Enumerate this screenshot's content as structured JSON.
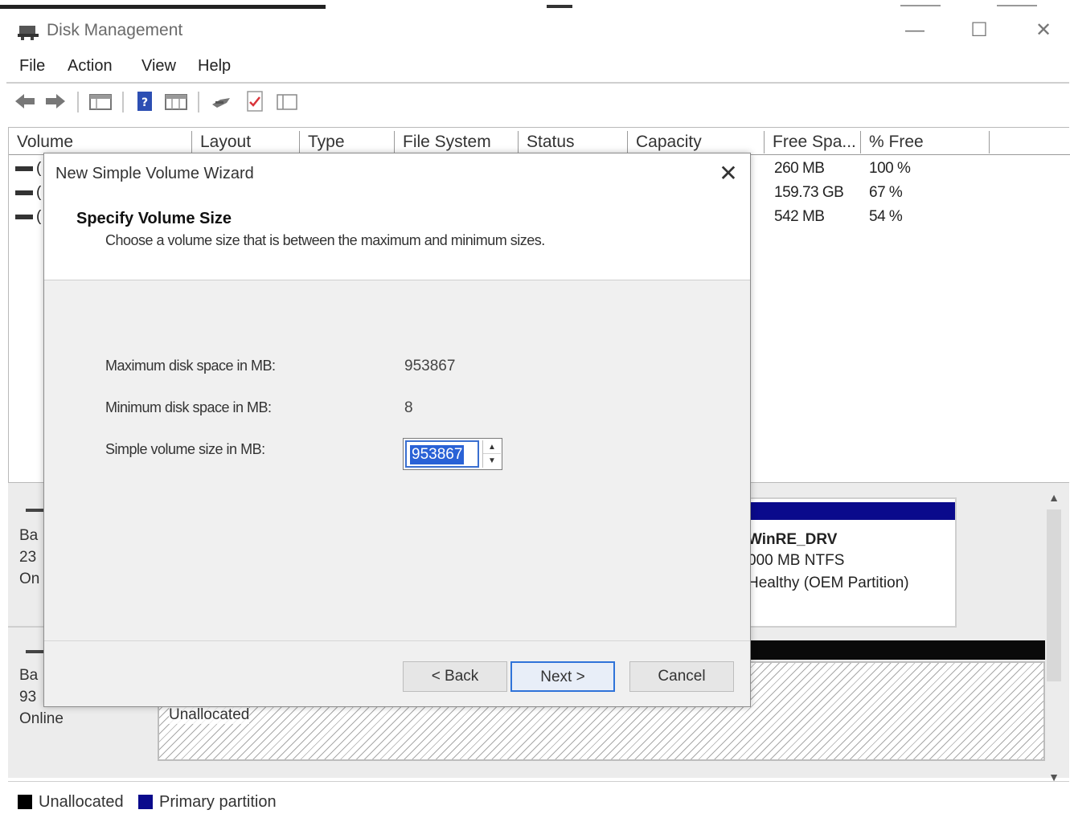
{
  "window": {
    "title": "Disk Management",
    "controls": {
      "minimize": "—",
      "maximize": "☐",
      "close": "✕"
    }
  },
  "menu": [
    "File",
    "Action",
    "View",
    "Help"
  ],
  "toolbar_icons": [
    "back-arrow-icon",
    "forward-arrow-icon",
    "console-tree-icon",
    "help-icon",
    "properties-icon",
    "connect-icon",
    "checklist-icon",
    "panel-icon"
  ],
  "volume_list": {
    "columns": [
      "Volume",
      "Layout",
      "Type",
      "File System",
      "Status",
      "Capacity",
      "Free Spa...",
      "% Free"
    ],
    "rows": [
      {
        "volume": "(",
        "free": "260 MB",
        "pct": "100 %"
      },
      {
        "volume": "(",
        "free": "159.73 GB",
        "pct": "67 %"
      },
      {
        "volume": "(",
        "free": "542 MB",
        "pct": "54 %"
      }
    ]
  },
  "graph": {
    "disk0": {
      "line1": "Ba",
      "line2": "23",
      "line3": "On"
    },
    "disk1": {
      "line1": "Ba",
      "line2": "93",
      "line3": "Online"
    },
    "oem_volume": {
      "name": "WinRE_DRV",
      "size": "000 MB NTFS",
      "status": "Healthy (OEM Partition)"
    },
    "unallocated_label": "Unallocated"
  },
  "legend": [
    {
      "label": "Unallocated",
      "color": "#000000"
    },
    {
      "label": "Primary partition",
      "color": "#0a0a8c"
    }
  ],
  "dialog": {
    "title": "New Simple Volume Wizard",
    "heading": "Specify Volume Size",
    "subheading": "Choose a volume size that is between the maximum and minimum sizes.",
    "max_label": "Maximum disk space in MB:",
    "max_value": "953867",
    "min_label": "Minimum disk space in MB:",
    "min_value": "8",
    "size_label": "Simple volume size in MB:",
    "size_value": "953867",
    "buttons": {
      "back": "< Back",
      "next": "Next >",
      "cancel": "Cancel"
    }
  },
  "colors": {
    "primary_partition": "#0a0a8c",
    "unallocated": "#0a0a0a",
    "selection": "#2a62d6"
  }
}
